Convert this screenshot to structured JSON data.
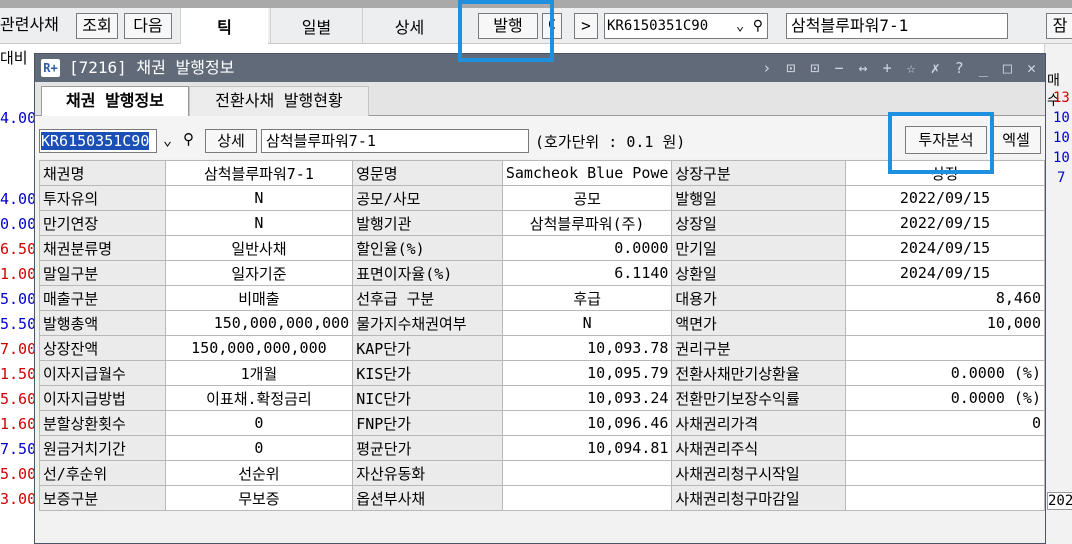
{
  "parent": {
    "related_label": "관련사채",
    "btn_query": "조회",
    "btn_next": "다음",
    "tabs": [
      "틱",
      "일별",
      "상세"
    ],
    "btn_issue": "발행",
    "btn_refresh": "C",
    "btn_arrow": ">",
    "bond_code": "KR6150351C90",
    "bond_name": "삼척블루파워7-1",
    "right_cut": "잠",
    "left_header": "대비",
    "left_values": [
      "4.00",
      "4.00",
      "0.00",
      "6.50",
      "1.00",
      "5.00",
      "5.50",
      "7.00",
      "1.50",
      "5.60",
      "1.60",
      "7.50",
      "5.00",
      "3.00"
    ],
    "right_cut_vals": [
      "매수",
      "13",
      "10",
      "10",
      "10",
      "7",
      "202"
    ]
  },
  "dialog": {
    "logo": "R+",
    "title": "[7216] 채권 발행정보",
    "controls": "› ⊡ ⊡ − ↔ + ☆ ✗ ? _ □ ✕",
    "tabs": [
      {
        "label": "채권 발행정보",
        "active": true
      },
      {
        "label": "전환사채 발행현황",
        "active": false
      }
    ],
    "toolbar": {
      "code": "KR6150351C90",
      "detail_button": "상세",
      "name": "삼척블루파워7-1",
      "tick_unit": "(호가단위 : 0.1  원)",
      "invest_button": "투자분석",
      "excel_button": "엑셀"
    },
    "rows": [
      [
        "채권명",
        "삼척블루파워7-1",
        "영문명",
        "Samcheok Blue Powe",
        "상장구분",
        "상장"
      ],
      [
        "투자유의",
        "N",
        "공모/사모",
        "공모",
        "발행일",
        "2022/09/15"
      ],
      [
        "만기연장",
        "N",
        "발행기관",
        "삼척블루파워(주)",
        "상장일",
        "2022/09/15"
      ],
      [
        "채권분류명",
        "일반사채",
        "할인율(%)",
        "0.0000",
        "만기일",
        "2024/09/15"
      ],
      [
        "말일구분",
        "일자기준",
        "표면이자율(%)",
        "6.1140",
        "상환일",
        "2024/09/15"
      ],
      [
        "매출구분",
        "비매출",
        "선후급 구분",
        "후급",
        "대용가",
        "8,460"
      ],
      [
        "발행총액",
        "150,000,000,000",
        "물가지수채권여부",
        "N",
        "액면가",
        "10,000"
      ],
      [
        "상장잔액",
        "150,000,000,000",
        "KAP단가",
        "10,093.78",
        "권리구분",
        ""
      ],
      [
        "이자지급월수",
        "1개월",
        "KIS단가",
        "10,095.79",
        "전환사채만기상환율",
        "0.0000 (%)"
      ],
      [
        "이자지급방법",
        "이표채.확정금리",
        "NIC단가",
        "10,093.24",
        "전환만기보장수익률",
        "0.0000 (%)"
      ],
      [
        "분할상환횟수",
        "0",
        "FNP단가",
        "10,096.46",
        "사채권리가격",
        "0"
      ],
      [
        "원금거치기간",
        "0",
        "평균단가",
        "10,094.81",
        "사채권리주식",
        ""
      ],
      [
        "선/후순위",
        "선순위",
        "자산유동화",
        "",
        "사채권리청구시작일",
        ""
      ],
      [
        "보증구분",
        "무보증",
        "옵션부사채",
        "",
        "사채권리청구마감일",
        ""
      ]
    ]
  },
  "colors": {
    "highlight": "#1e90e0",
    "title_bar": "#606a79",
    "selection": "#1c4fb5",
    "left_up": "#d00000",
    "left_down": "#0000cc"
  }
}
